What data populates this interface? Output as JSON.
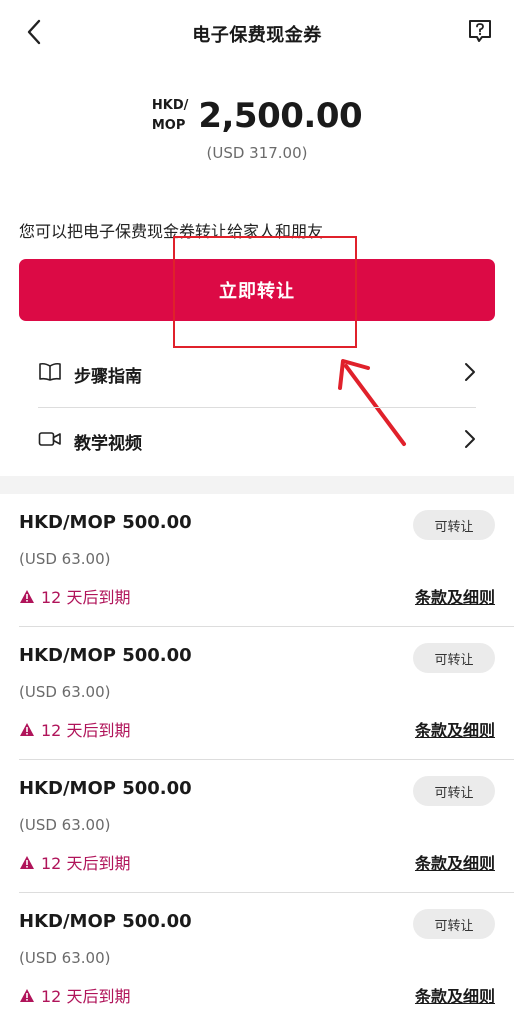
{
  "header": {
    "title": "电子保费现金券"
  },
  "summary": {
    "currency_line1": "HKD/",
    "currency_line2": "MOP",
    "amount": "2,500.00",
    "usd_equivalent": "(USD 317.00)"
  },
  "transfer": {
    "hint": "您可以把电子保费现金券转让给家人和朋友",
    "button_label": "立即转让"
  },
  "menu": {
    "guide_label": "步骤指南",
    "video_label": "教学视频"
  },
  "vouchers": [
    {
      "amount": "HKD/MOP 500.00",
      "usd": "(USD 63.00)",
      "badge": "可转让",
      "expiry": "12 天后到期",
      "terms": "条款及细则"
    },
    {
      "amount": "HKD/MOP 500.00",
      "usd": "(USD 63.00)",
      "badge": "可转让",
      "expiry": "12 天后到期",
      "terms": "条款及细则"
    },
    {
      "amount": "HKD/MOP 500.00",
      "usd": "(USD 63.00)",
      "badge": "可转让",
      "expiry": "12 天后到期",
      "terms": "条款及细则"
    },
    {
      "amount": "HKD/MOP 500.00",
      "usd": "(USD 63.00)",
      "badge": "可转让",
      "expiry": "12 天后到期",
      "terms": "条款及细则"
    }
  ],
  "icons": {
    "back": "chevron-left-icon",
    "help": "help-question-icon",
    "guide": "book-icon",
    "video": "video-camera-icon",
    "chevron": "chevron-right-icon",
    "warning": "warning-triangle-icon"
  },
  "colors": {
    "primary": "#dc0a45",
    "expiry_text": "#b0145a",
    "annotation": "#e0212b"
  }
}
